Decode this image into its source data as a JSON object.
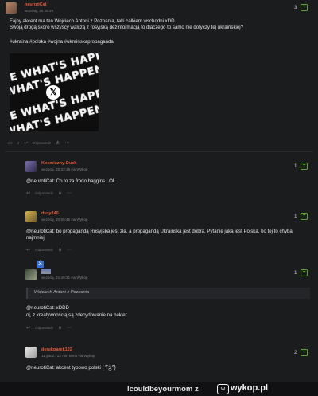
{
  "posts": {
    "main": {
      "author": "neurotiCat",
      "meta": "wczoraj, 20:26:15",
      "votes": "3",
      "line1": "Fajny akcent ma ten Wojciech Antoni z Poznania, taki całkiem wschodni xDD",
      "line2": "Swoją drogą skoro wszyscy walczą z rosyjską dezinformacją to dlaczego to samo nie dotyczy tej ukraińskiej?",
      "tags": "#ukraina #polska #wojna #ukrainskapropaganda",
      "comment_count": "4",
      "reply_label": "Odpowiedz",
      "image_text": "SEE WHAT'S HAPPENING",
      "image_logo": "𝕏"
    },
    "c1": {
      "author": "Kosmiczny-Duch",
      "meta": "wczoraj, 20:33:19",
      "via": "via Wykop",
      "votes": "1",
      "line1": "@neurotiCat: Co to za frodo baggins LOL",
      "reply_label": "Odpowiedz"
    },
    "c2": {
      "author": "duzy240",
      "meta": "wczoraj, 20:55:46",
      "via": "via Wykop",
      "votes": "1",
      "line1": "@neurotiCat: bo propagandą Rosyjska jest zła, a propagandą Ukraińska jest dobra. Pytanie jaka jest Polska, bo tej to chyba",
      "line2": "najmniej",
      "reply_label": "Odpowiedz"
    },
    "c3": {
      "meta": "wczoraj, 21:49:31",
      "via": "via Wykop",
      "votes": "1",
      "quote": "Wojciech Antoni z Poznania",
      "line1": "@neurotiCat: xDDD",
      "line2": "oj, z kreatywnością są zdecydowanie na bakier",
      "reply_label": "Odpowiedz"
    },
    "c4": {
      "author": "derukparek122",
      "meta": "11 godz., 22 min temu",
      "via": "via Wykop",
      "votes": "2",
      "line1": "@neurotiCat: akcent typowo polski ( ͡° ͜ʖ ͡°)"
    }
  },
  "footer": {
    "user": "lcouldbeyourmom",
    "separator": "z",
    "brand": "wykop.pl",
    "brand_icon": "wykop-logo"
  },
  "colors": {
    "background": "#1b1c1e",
    "author": "#e05a3a",
    "plus": "#5ba331"
  }
}
